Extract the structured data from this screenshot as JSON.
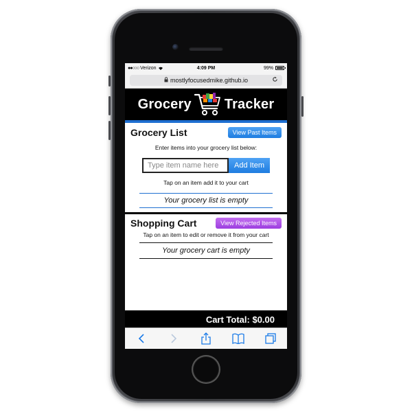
{
  "status_bar": {
    "carrier": "Verizon",
    "signal": "●●○○○",
    "time": "4:09 PM",
    "battery": "99%",
    "battery_level": 0.99
  },
  "url_bar": {
    "url": "mostlyfocusedmike.github.io"
  },
  "app_header": {
    "title_left": "Grocery",
    "title_right": "Tracker",
    "accent_color": "#1e6fd1"
  },
  "grocery_list": {
    "title": "Grocery List",
    "view_past_label": "View Past Items",
    "instruction": "Enter items into your grocery list below:",
    "input_placeholder": "Type item name here",
    "input_value": "",
    "add_button_label": "Add Item",
    "hint": "Tap on an item add it to your cart",
    "empty_message": "Your grocery list is empty"
  },
  "shopping_cart": {
    "title": "Shopping Cart",
    "view_rejected_label": "View Rejected Items",
    "instruction": "Tap on an item to edit or remove it from your cart",
    "empty_message": "Your grocery cart is empty"
  },
  "cart_total": {
    "label": "Cart Total: $0.00"
  },
  "toolbar": {
    "icons": [
      "back-icon",
      "forward-icon",
      "share-icon",
      "bookmarks-icon",
      "tabs-icon"
    ],
    "color": "#1a7ae8"
  }
}
